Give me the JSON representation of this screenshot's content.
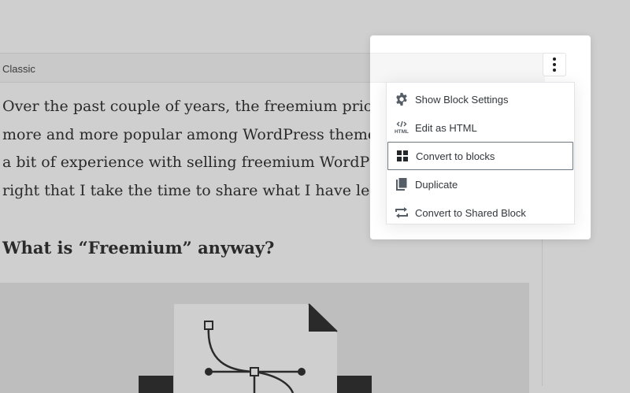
{
  "block": {
    "label": "Classic"
  },
  "content": {
    "paragraph_lines": [
      "Over the past couple of years, the freemium pricing stra",
      "more and more popular among WordPress theme and p",
      "a bit of experience with selling freemium WordPress the",
      "right that I take the time to share what I have learned so"
    ],
    "heading": "What is “Freemium” anyway?"
  },
  "toolbar": {
    "more_options_icon": "vertical-ellipsis-icon"
  },
  "menu": {
    "items": [
      {
        "label": "Show Block Settings",
        "icon": "gear-icon"
      },
      {
        "label": "Edit as HTML",
        "icon": "html-icon"
      },
      {
        "label": "Convert to blocks",
        "icon": "grid-icon",
        "focused": true
      },
      {
        "label": "Duplicate",
        "icon": "duplicate-icon"
      },
      {
        "label": "Convert to Shared Block",
        "icon": "repeat-icon"
      }
    ],
    "html_icon_text": "HTML"
  },
  "colors": {
    "overlay_bg": "#cfcfcf",
    "menu_text": "#32373c",
    "focus_border": "#6c7781"
  }
}
